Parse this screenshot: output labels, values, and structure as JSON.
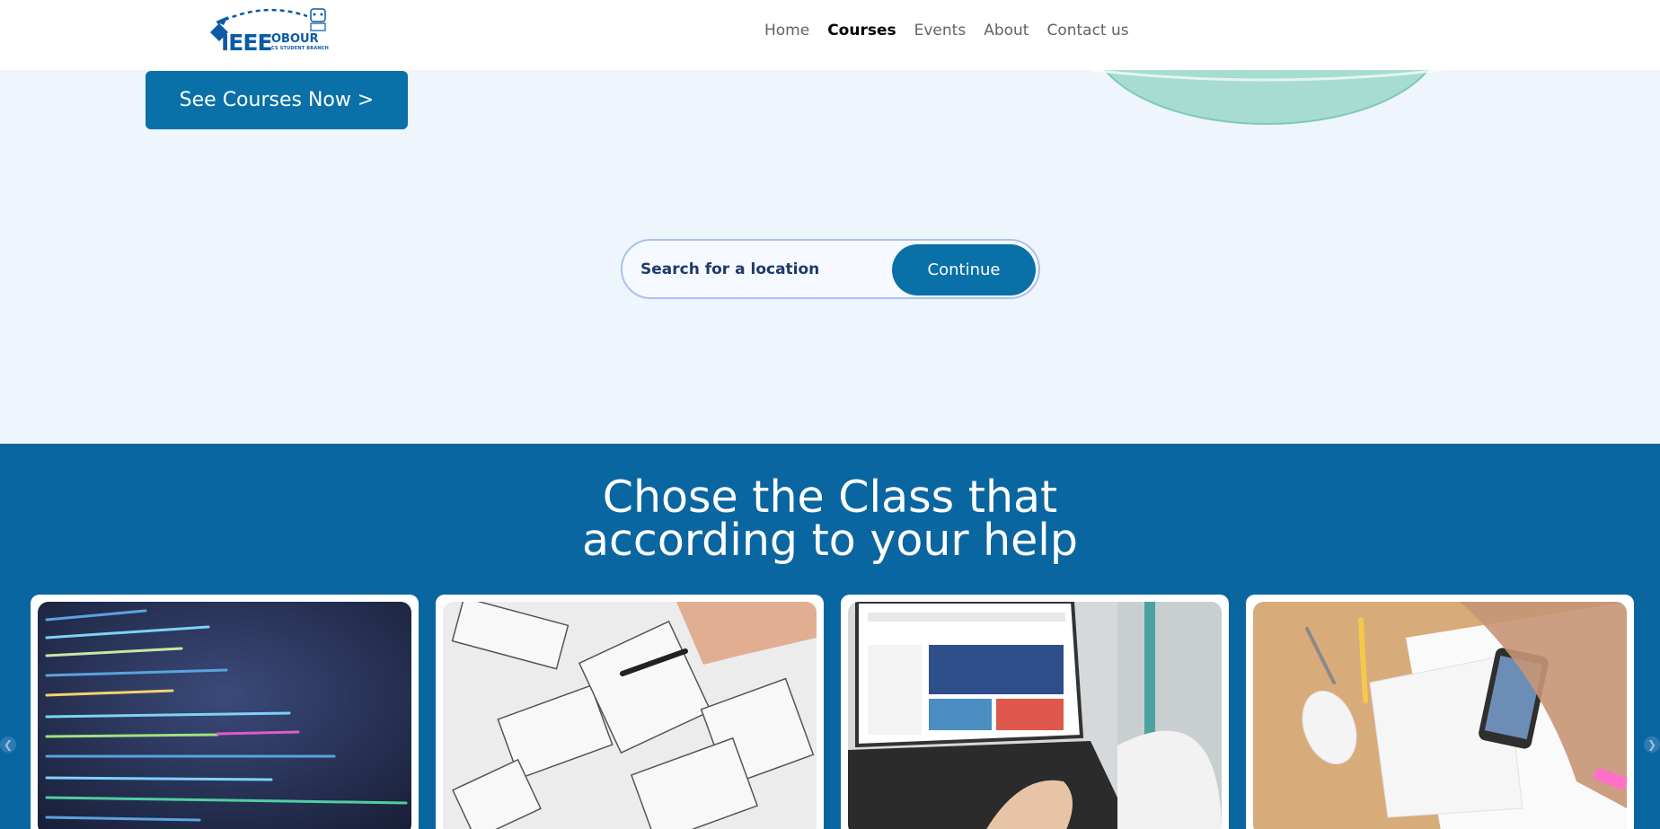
{
  "header": {
    "logo_main": "IEEE",
    "logo_sub": "OBOUR",
    "logo_small": "CS STUDENT BRANCH",
    "nav": [
      {
        "label": "Home",
        "active": false
      },
      {
        "label": "Courses",
        "active": true
      },
      {
        "label": "Events",
        "active": false
      },
      {
        "label": "About",
        "active": false
      },
      {
        "label": "Contact us",
        "active": false
      }
    ]
  },
  "hero": {
    "cta_label": "See Courses Now >"
  },
  "search": {
    "placeholder": "Search for a location",
    "button_label": "Continue"
  },
  "classes": {
    "title_line1": "Chose the Class that",
    "title_line2": "according to your help",
    "cards": [
      {
        "image": "code-screen-image"
      },
      {
        "image": "wireframe-sketch-image"
      },
      {
        "image": "laptop-website-image"
      },
      {
        "image": "desk-phone-sketch-image"
      }
    ]
  },
  "colors": {
    "brand": "#0a70a8",
    "section_bg": "#0a66a0",
    "page_bg": "#eef5fd"
  }
}
